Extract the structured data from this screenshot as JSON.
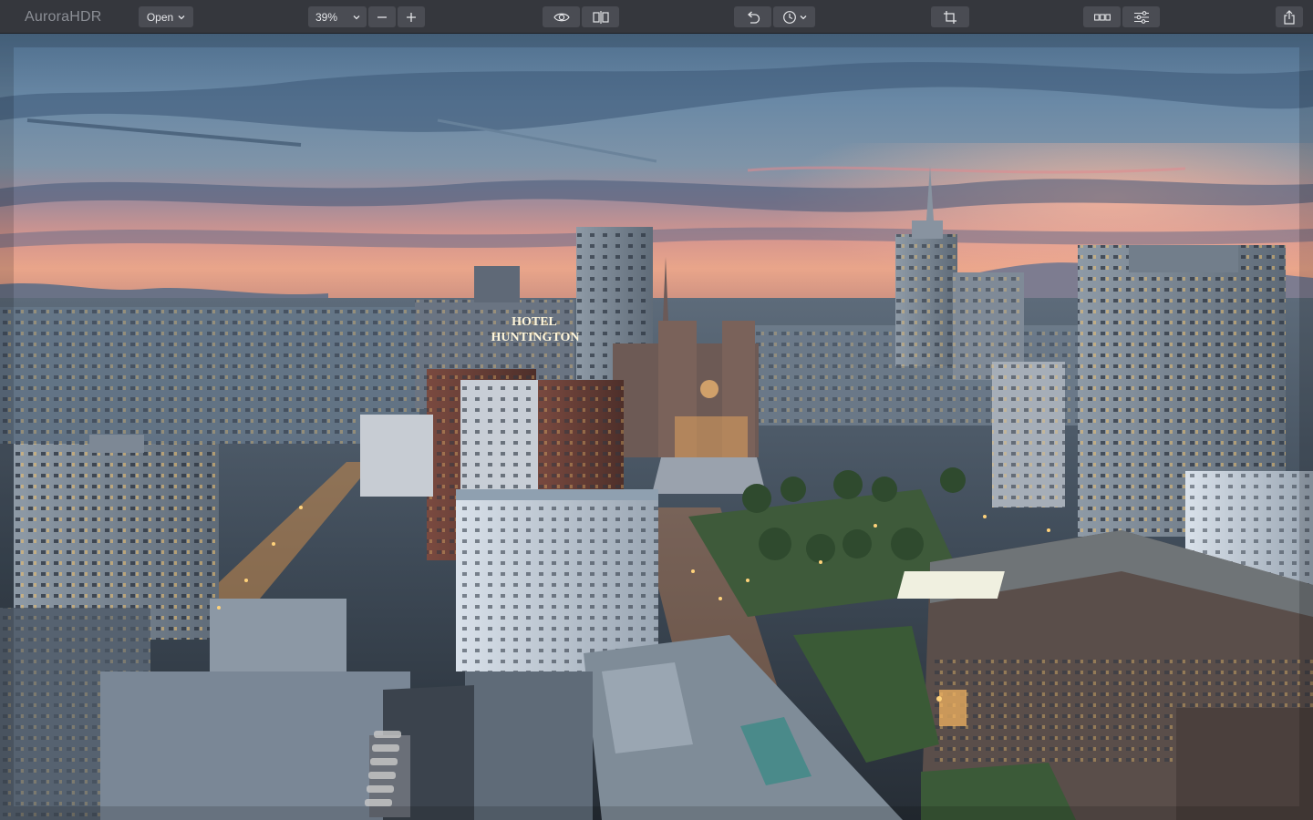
{
  "app": {
    "logo_text": "AuroraHDR"
  },
  "toolbar": {
    "open_label": "Open",
    "zoom_value": "39%",
    "icons": {
      "zoom_out": "minus-icon",
      "zoom_in": "plus-icon",
      "preview": "eye-icon",
      "compare": "split-compare-icon",
      "undo": "undo-icon",
      "history": "clock-icon",
      "crop": "crop-icon",
      "filmstrip": "filmstrip-icon",
      "adjustments": "sliders-icon",
      "share": "share-icon"
    }
  },
  "photo": {
    "sign_line1": "HOTEL",
    "sign_line2": "HUNTINGTON"
  },
  "colors": {
    "toolbar_bg": "#35373d",
    "button_bg": "#4a4c53",
    "icon": "#e4e5e8",
    "logo": "#8b8e95"
  }
}
